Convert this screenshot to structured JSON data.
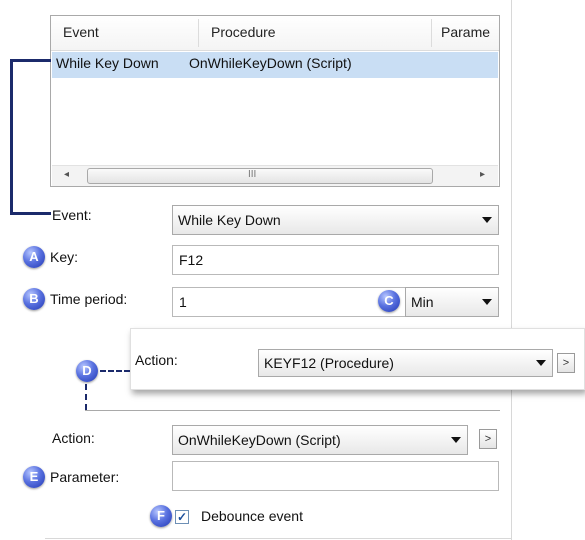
{
  "grid": {
    "columns": [
      "Event",
      "Procedure",
      "Parame"
    ],
    "rows": [
      {
        "event": "While Key Down",
        "procedure": "OnWhileKeyDown (Script)",
        "parameter": ""
      }
    ],
    "scroll_left": "◂",
    "scroll_grip": "III",
    "scroll_right": "▸"
  },
  "form": {
    "event_label": "Event:",
    "event_value": "While Key Down",
    "key_label": "Key:",
    "key_value": "F12",
    "time_label": "Time period:",
    "time_value": "1",
    "unit_value": "Min",
    "popout_action_label": "Action:",
    "popout_action_value": "KEYF12 (Procedure)",
    "popout_more": ">",
    "action_label": "Action:",
    "action_value": "OnWhileKeyDown (Script)",
    "action_more": ">",
    "parameter_label": "Parameter:",
    "parameter_value": "",
    "debounce_label": "Debounce event",
    "debounce_checked": "✓"
  },
  "callouts": {
    "a": "A",
    "b": "B",
    "c": "C",
    "d": "D",
    "e": "E",
    "f": "F"
  },
  "colors": {
    "badge": "#2b47c9",
    "selection": "#c9def4",
    "connector": "#1b2a6b"
  }
}
